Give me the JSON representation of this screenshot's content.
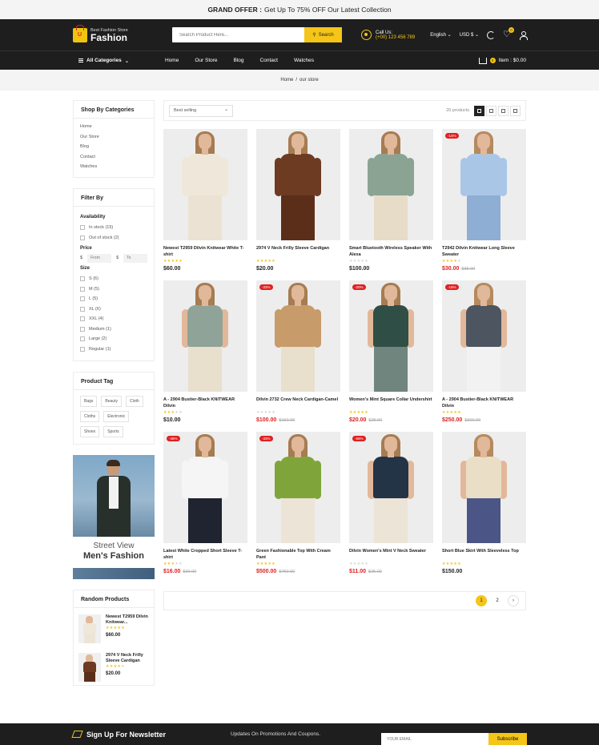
{
  "offer": {
    "label": "GRAND OFFER :",
    "text": "Get Up To 75% OFF Our Latest Collection"
  },
  "header": {
    "logo_small": "Best Fashion Store",
    "logo_big": "Fashion",
    "search_placeholder": "Search Product Here...",
    "search_button": "Search",
    "contact_label": "Call Us:",
    "contact_phone": "(+00) 123 456 789",
    "language": "English",
    "currency": "USD $",
    "wishlist_count": "0"
  },
  "nav": {
    "all_categories": "All Categories",
    "links": [
      "Home",
      "Our Store",
      "Blog",
      "Contact",
      "Watches"
    ],
    "cart_count": "0",
    "cart_text": "Item : $0.00"
  },
  "breadcrumb": {
    "home": "Home",
    "sep": "/",
    "current": "our store"
  },
  "sidebar": {
    "categories_title": "Shop By Categories",
    "categories": [
      "Home",
      "Our Store",
      "Blog",
      "Contact",
      "Watches"
    ],
    "filter_title": "Filter By",
    "availability_title": "Availability",
    "availability": [
      "In stock (15)",
      "Out of stock (2)"
    ],
    "price_title": "Price",
    "price_currency": "$",
    "price_from": "From",
    "price_to": "To",
    "size_title": "Size",
    "sizes": [
      "S (6)",
      "M (5)",
      "L (5)",
      "XL (6)",
      "XXL (4)",
      "Medium (1)",
      "Large (2)",
      "Regular (1)"
    ],
    "tags_title": "Product Tag",
    "tags": [
      "Bags",
      "Beauty",
      "Cloth",
      "Cloths",
      "Electronic",
      "Shoes",
      "Sports"
    ],
    "banner_line1": "Street View",
    "banner_line2": "Men's Fashion",
    "random_title": "Random Products",
    "random_products": [
      {
        "name": "Newest T2959 Dilvin Knitwear...",
        "price": "$60.00",
        "rating": 5,
        "top": "#efe7da",
        "bottom": "#ece4d6"
      },
      {
        "name": "2974 V Neck Frilly Sleeve Cardigan",
        "price": "$20.00",
        "rating": 4,
        "top": "#6d3a22",
        "bottom": "#5b2e1a"
      }
    ]
  },
  "toolbar": {
    "sort": "Best selling",
    "count": "20 products"
  },
  "products": [
    {
      "name": "Newest T2959 Dilvin Knitwear White T-shirt",
      "price": "$60.00",
      "old": "",
      "sale": "",
      "rating": 5,
      "top": "#efe7da",
      "bottom": "#ebe2d3",
      "hair": "#a67c52",
      "sleeveless": false
    },
    {
      "name": "2974 V Neck Frilly Sleeve Cardigan",
      "price": "$20.00",
      "old": "",
      "sale": "",
      "rating": 5,
      "top": "#6d3a22",
      "bottom": "#5b2e1a",
      "hair": "#a67c52",
      "sleeveless": false
    },
    {
      "name": "Smart Bluetooth Wireless Speaker With Alexa",
      "price": "$100.00",
      "old": "",
      "sale": "",
      "rating": 0,
      "top": "#8aa393",
      "bottom": "#e7dcc8",
      "hair": "#a67c52",
      "sleeveless": false
    },
    {
      "name": "T2942 Dilvin Knitwear Long Sleeve Sweater",
      "price": "$30.00",
      "old": "$35.00",
      "sale": "-14%",
      "rating": 4,
      "top": "#a9c6e6",
      "bottom": "#8eaed4",
      "hair": "#b58a5e",
      "sleeveless": false
    },
    {
      "name": "A - 2904 Bustier-Black KNITWEAR Dilvin",
      "price": "$10.00",
      "old": "",
      "sale": "",
      "rating": 3,
      "top": "#8fa398",
      "bottom": "#e8dfcd",
      "hair": "#a67c52",
      "sleeveless": true
    },
    {
      "name": "Dilvin 2732 Crew Neck Cardigan-Camel",
      "price": "$100.00",
      "old": "$150.00",
      "sale": "-33%",
      "rating": 0,
      "top": "#c89b6b",
      "bottom": "#e8dfcd",
      "hair": "#a67c52",
      "sleeveless": false
    },
    {
      "name": "Women's Mint Square Collar Undershirt",
      "price": "$20.00",
      "old": "$25.00",
      "sale": "-20%",
      "rating": 5,
      "top": "#2f4f46",
      "bottom": "#6f857d",
      "hair": "#a67c52",
      "sleeveless": true
    },
    {
      "name": "A - 2904 Bustier-Black KNITWEAR Dilvin",
      "price": "$250.00",
      "old": "$300.00",
      "sale": "-16%",
      "rating": 5,
      "top": "#4c5560",
      "bottom": "#f2f2f2",
      "hair": "#b58a5e",
      "sleeveless": true
    },
    {
      "name": "Latest White Cropped Short Sleeve T-shirt",
      "price": "$16.00",
      "old": "$30.00",
      "sale": "-46%",
      "rating": 3,
      "top": "#f5f5f5",
      "bottom": "#1f2430",
      "hair": "#a67c52",
      "sleeveless": false
    },
    {
      "name": "Green Fashionable Top With Cream Pant",
      "price": "$500.00",
      "old": "$750.00",
      "sale": "-33%",
      "rating": 5,
      "top": "#7fa53a",
      "bottom": "#ece4d6",
      "hair": "#a67c52",
      "sleeveless": false
    },
    {
      "name": "Dilvin Women's Mint V Neck Sweater",
      "price": "$11.00",
      "old": "$25.00",
      "sale": "-56%",
      "rating": 0,
      "top": "#243447",
      "bottom": "#ece4d6",
      "hair": "#a67c52",
      "sleeveless": true
    },
    {
      "name": "Short Blue Skirt With Sleeveless Top",
      "price": "$150.00",
      "old": "",
      "sale": "",
      "rating": 5,
      "top": "#eadfc6",
      "bottom": "#4b5687",
      "hair": "#b58a5e",
      "sleeveless": true
    }
  ],
  "pagination": {
    "pages": [
      "1",
      "2"
    ],
    "next": "›"
  },
  "footer": {
    "title": "Sign Up For Newsletter",
    "text": "Updates On Promotions And Coupons.",
    "placeholder": "YOUR EMAIL",
    "button": "Subscribe"
  },
  "colors": {
    "accent": "#f5c518",
    "dark": "#1e1e1e",
    "sale": "#e02020"
  }
}
